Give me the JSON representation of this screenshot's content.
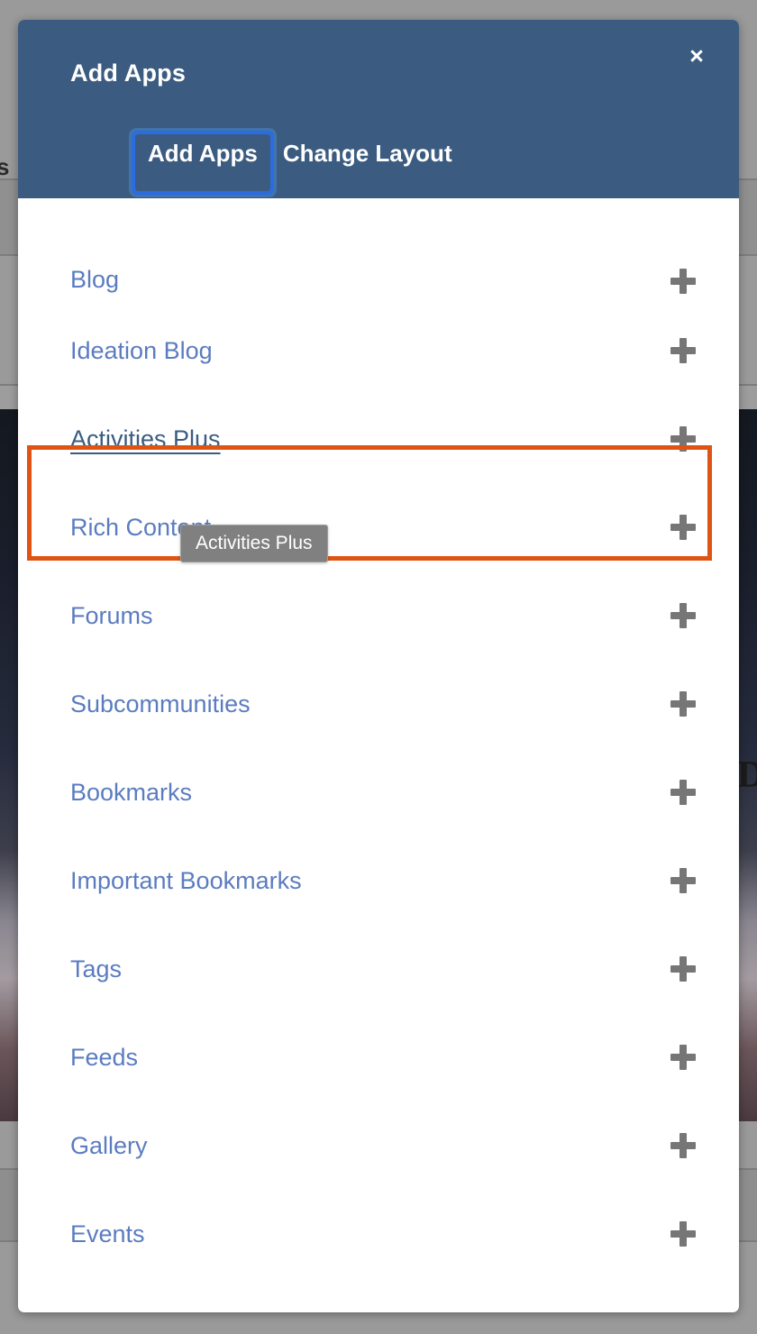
{
  "modal": {
    "title": "Add Apps",
    "close_label": "×",
    "close_icon": "close-icon",
    "tabs": [
      {
        "label": "Add Apps",
        "focused": true
      },
      {
        "label": "Change Layout",
        "focused": false
      }
    ],
    "apps": [
      {
        "label": "Blog",
        "add_icon": "plus-icon",
        "hovered": false
      },
      {
        "label": "Ideation Blog",
        "add_icon": "plus-icon",
        "hovered": false
      },
      {
        "label": "Activities Plus",
        "add_icon": "plus-icon",
        "hovered": true
      },
      {
        "label": "Rich Content",
        "add_icon": "plus-icon",
        "hovered": false
      },
      {
        "label": "Forums",
        "add_icon": "plus-icon",
        "hovered": false
      },
      {
        "label": "Subcommunities",
        "add_icon": "plus-icon",
        "hovered": false
      },
      {
        "label": "Bookmarks",
        "add_icon": "plus-icon",
        "hovered": false
      },
      {
        "label": "Important Bookmarks",
        "add_icon": "plus-icon",
        "hovered": false
      },
      {
        "label": "Tags",
        "add_icon": "plus-icon",
        "hovered": false
      },
      {
        "label": "Feeds",
        "add_icon": "plus-icon",
        "hovered": false
      },
      {
        "label": "Gallery",
        "add_icon": "plus-icon",
        "hovered": false
      },
      {
        "label": "Events",
        "add_icon": "plus-icon",
        "hovered": false
      }
    ],
    "tooltip": {
      "text": "Activities Plus"
    }
  },
  "background": {
    "right_text": "Da",
    "left_text": "s"
  },
  "colors": {
    "header_blue": "#3b5c80",
    "link_blue": "#5b7cc0",
    "link_hover_blue": "#3b5c80",
    "highlight_orange": "#df5413",
    "focus_ring_blue": "#2b6ce0",
    "plus_gray": "#767676",
    "tooltip_gray": "#808080",
    "overlay_gray": "#9a9a9a",
    "modal_white": "#ffffff"
  }
}
